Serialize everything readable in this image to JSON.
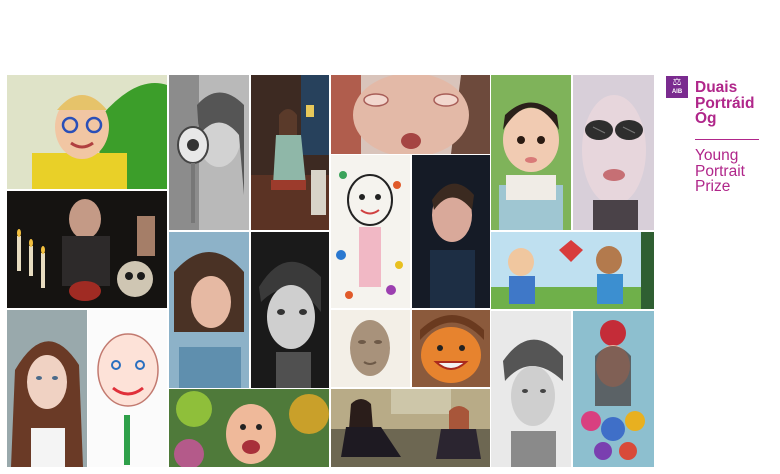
{
  "brand": {
    "logo_text": "AIB",
    "title_irish": [
      "Duais",
      "Portráid",
      "Óg"
    ],
    "title_english": [
      "Young",
      "Portrait",
      "Prize"
    ],
    "accent_color": "#b0268a",
    "logo_color": "#7a2b8f"
  },
  "portraits": [
    {
      "name": "boy-with-glasses-portrait"
    },
    {
      "name": "woman-with-wine-glass-drawing"
    },
    {
      "name": "woman-on-chair-painting"
    },
    {
      "name": "distorted-face-painting"
    },
    {
      "name": "toddler-portrait-painting"
    },
    {
      "name": "woman-with-sunglasses-painting"
    },
    {
      "name": "colourful-child-drawing"
    },
    {
      "name": "young-man-dark-background-painting"
    },
    {
      "name": "candles-and-skull-painting"
    },
    {
      "name": "girl-blue-background-painting"
    },
    {
      "name": "black-and-white-boy-portrait"
    },
    {
      "name": "children-with-kite-painting"
    },
    {
      "name": "clay-head-sculpture"
    },
    {
      "name": "smiling-orange-face-painting"
    },
    {
      "name": "pencil-boy-portrait"
    },
    {
      "name": "girl-with-flowers-painting"
    },
    {
      "name": "young-woman-portrait"
    },
    {
      "name": "crayon-face-drawing"
    },
    {
      "name": "leafy-face-painting"
    },
    {
      "name": "two-women-on-sofa-painting"
    }
  ]
}
